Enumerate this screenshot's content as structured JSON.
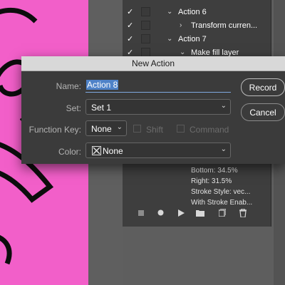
{
  "actions_panel": {
    "rows": [
      {
        "check": "✓",
        "label": "Action 6",
        "expanded": true
      },
      {
        "check": "✓",
        "label": "Transform curren...",
        "expanded": false
      },
      {
        "check": "✓",
        "label": "Action 7",
        "expanded": true
      },
      {
        "check": "✓",
        "label": "Make fill layer",
        "expanded": true
      }
    ],
    "details": [
      "Bottom: 34.5%",
      "Right: 31.5%",
      "Stroke Style: vec...",
      "With Stroke Enab..."
    ],
    "toolbar_icons": [
      "stop-icon",
      "record-icon",
      "play-icon",
      "folder-icon",
      "new-action-icon",
      "trash-icon"
    ]
  },
  "dialog": {
    "title": "New Action",
    "name_label": "Name:",
    "name_value": "Action 8",
    "set_label": "Set:",
    "set_value": "Set 1",
    "function_key_label": "Function Key:",
    "function_key_value": "None",
    "shift_label": "Shift",
    "command_label": "Command",
    "color_label": "Color:",
    "color_value": "None",
    "record_label": "Record",
    "cancel_label": "Cancel"
  },
  "colors": {
    "canvas_pink": "#f25fc9",
    "dialog_bg": "#3b3b3b",
    "selection_blue": "#4e82c8"
  }
}
